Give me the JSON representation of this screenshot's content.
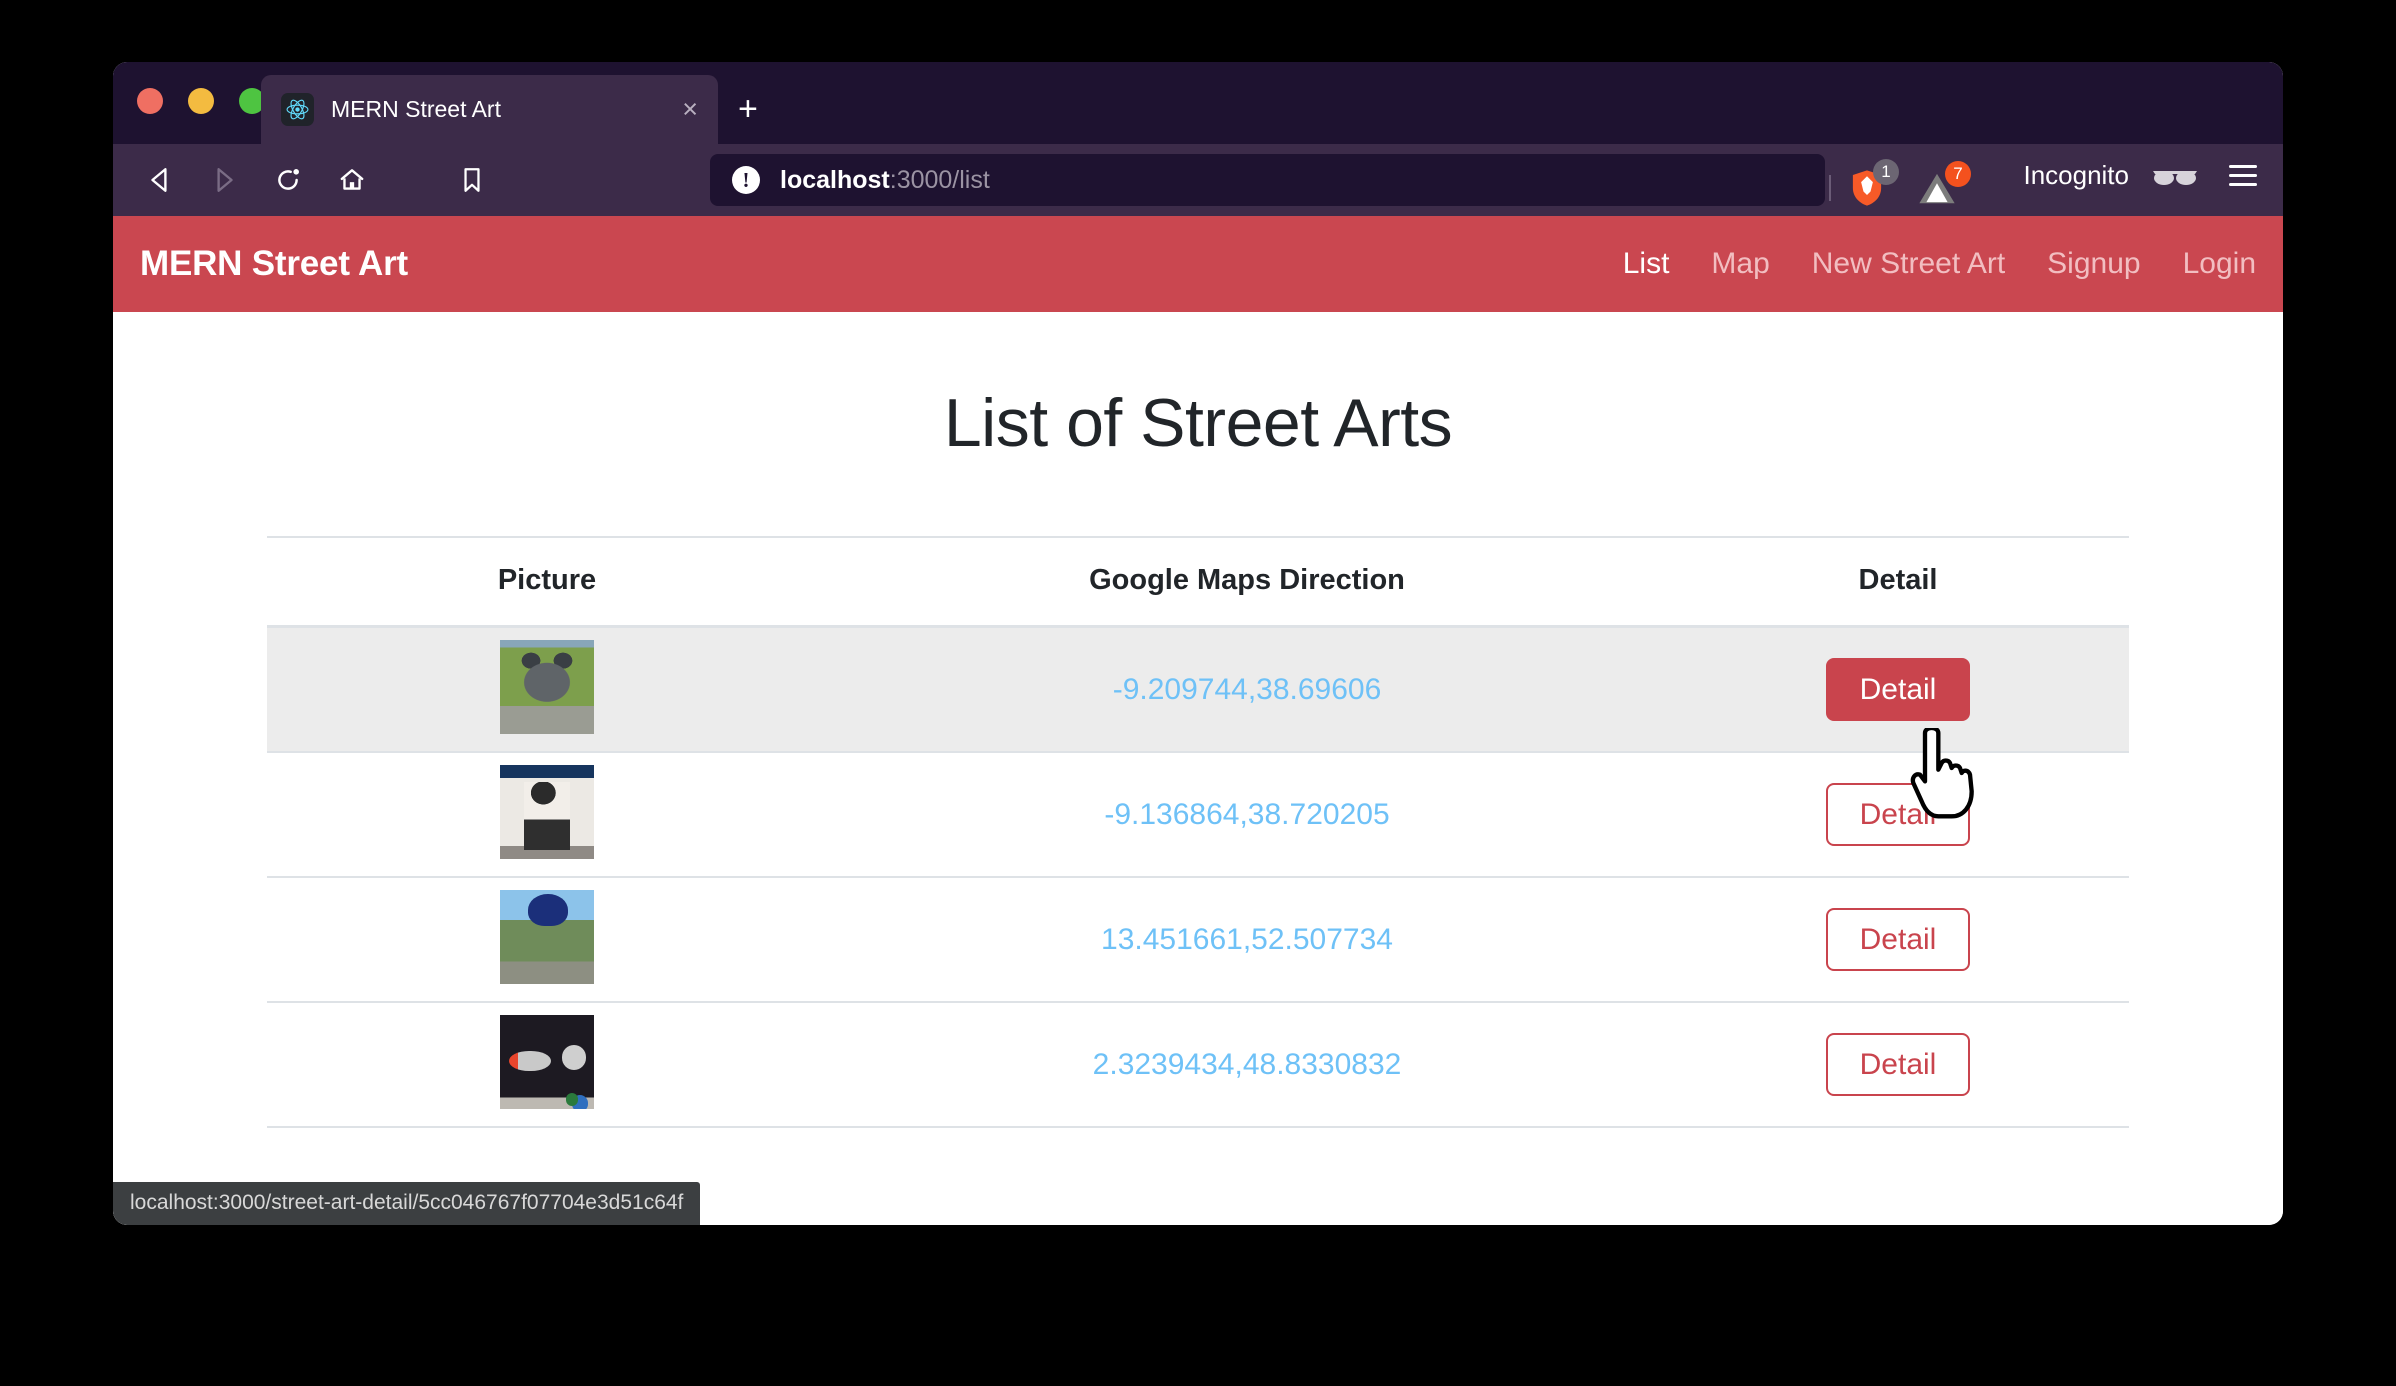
{
  "browser": {
    "tab": {
      "title": "MERN Street Art",
      "favicon": "react-logo-icon",
      "close_label": "×"
    },
    "new_tab_label": "+",
    "toolbar": {
      "back_icon": "back-arrow-icon",
      "forward_icon": "forward-arrow-icon",
      "reload_icon": "reload-icon",
      "home_icon": "home-icon",
      "bookmark_icon": "bookmark-icon"
    },
    "url": {
      "host": "localhost",
      "path": ":3000/list",
      "security_icon": "info-warning-icon"
    },
    "shields": {
      "brave_icon": "brave-lion-icon",
      "brave_count": "1",
      "triangle_icon": "triangle-icon",
      "triangle_count": "7"
    },
    "profile": {
      "label": "Incognito",
      "glasses_icon": "incognito-glasses-icon",
      "menu_icon": "hamburger-menu-icon"
    },
    "status_tooltip": "localhost:3000/street-art-detail/5cc046767f07704e3d51c64f"
  },
  "app": {
    "brand": "MERN Street Art",
    "nav_links": [
      {
        "label": "List",
        "active": true
      },
      {
        "label": "Map",
        "active": false
      },
      {
        "label": "New Street Art",
        "active": false
      },
      {
        "label": "Signup",
        "active": false
      },
      {
        "label": "Login",
        "active": false
      }
    ],
    "page_title": "List of Street Arts",
    "table": {
      "headers": [
        "Picture",
        "Google Maps Direction",
        "Detail"
      ],
      "rows": [
        {
          "thumb_alt": "street-art-thumbnail-bear-mural",
          "coords": "-9.209744,38.69606",
          "detail_label": "Detail",
          "hovered": true
        },
        {
          "thumb_alt": "street-art-thumbnail-woman-mural",
          "coords": "-9.136864,38.720205",
          "detail_label": "Detail",
          "hovered": false
        },
        {
          "thumb_alt": "street-art-thumbnail-jellyfish-sculpture",
          "coords": "13.451661,52.507734",
          "detail_label": "Detail",
          "hovered": false
        },
        {
          "thumb_alt": "street-art-thumbnail-rocket-moon-mural",
          "coords": "2.3239434,48.8330832",
          "detail_label": "Detail",
          "hovered": false
        }
      ]
    }
  },
  "colors": {
    "brand_red": "#ca4750",
    "link_blue": "#6ec1f7",
    "tab_strip": "#1e1230",
    "toolbar": "#3c2b49",
    "row_hover": "#ececec"
  }
}
